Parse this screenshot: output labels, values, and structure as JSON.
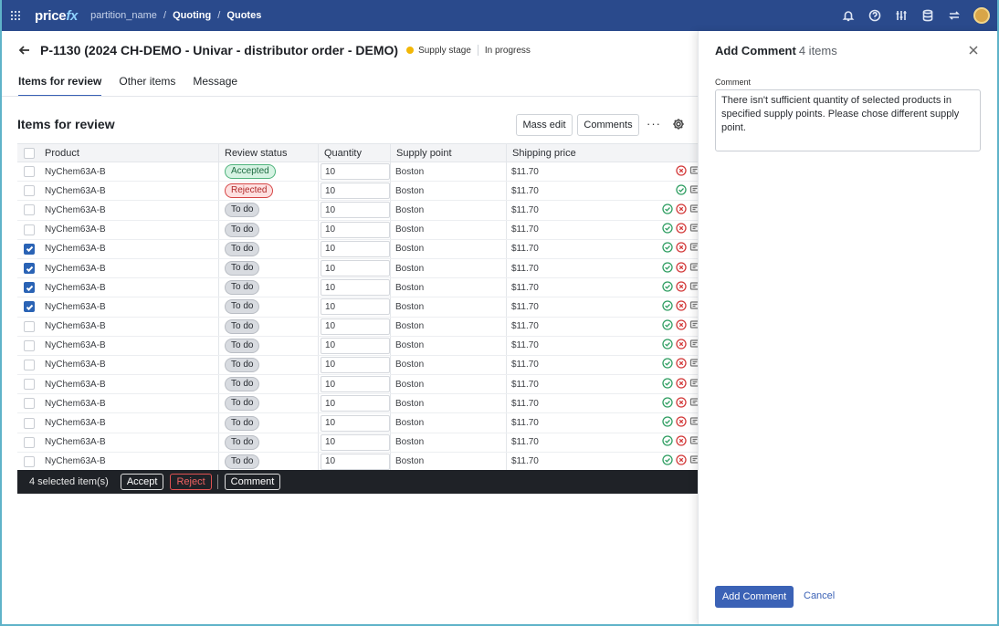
{
  "topbar": {
    "logo_main": "price",
    "logo_fx": "fx",
    "partition": "partition_name",
    "crumb_sep": "/",
    "crumb_quoting": "Quoting",
    "crumb_quotes": "Quotes"
  },
  "header": {
    "title": "P-1130 (2024 CH-DEMO - Univar - distributor order - DEMO)",
    "stage": "Supply stage",
    "status": "In progress"
  },
  "tabs": [
    {
      "label": "Items for review",
      "active": true
    },
    {
      "label": "Other items",
      "active": false
    },
    {
      "label": "Message",
      "active": false
    }
  ],
  "section": {
    "title": "Items for review",
    "mass_edit": "Mass edit",
    "comments": "Comments",
    "more": "···"
  },
  "table": {
    "columns": [
      "Product",
      "Review status",
      "Quantity",
      "Supply point",
      "Shipping price"
    ],
    "rows": [
      {
        "product": "NyChem63A-B",
        "status": "Accepted",
        "kind": "acc",
        "qty": "10",
        "supply": "Boston",
        "price": "$11.70",
        "checked": false,
        "actions": "no"
      },
      {
        "product": "NyChem63A-B",
        "status": "Rejected",
        "kind": "rej",
        "qty": "10",
        "supply": "Boston",
        "price": "$11.70",
        "checked": false,
        "actions": "ok"
      },
      {
        "product": "NyChem63A-B",
        "status": "To do",
        "kind": "todo",
        "qty": "10",
        "supply": "Boston",
        "price": "$11.70",
        "checked": false,
        "actions": "both"
      },
      {
        "product": "NyChem63A-B",
        "status": "To do",
        "kind": "todo",
        "qty": "10",
        "supply": "Boston",
        "price": "$11.70",
        "checked": false,
        "actions": "both"
      },
      {
        "product": "NyChem63A-B",
        "status": "To do",
        "kind": "todo",
        "qty": "10",
        "supply": "Boston",
        "price": "$11.70",
        "checked": true,
        "actions": "both"
      },
      {
        "product": "NyChem63A-B",
        "status": "To do",
        "kind": "todo",
        "qty": "10",
        "supply": "Boston",
        "price": "$11.70",
        "checked": true,
        "actions": "both"
      },
      {
        "product": "NyChem63A-B",
        "status": "To do",
        "kind": "todo",
        "qty": "10",
        "supply": "Boston",
        "price": "$11.70",
        "checked": true,
        "actions": "both"
      },
      {
        "product": "NyChem63A-B",
        "status": "To do",
        "kind": "todo",
        "qty": "10",
        "supply": "Boston",
        "price": "$11.70",
        "checked": true,
        "actions": "both"
      },
      {
        "product": "NyChem63A-B",
        "status": "To do",
        "kind": "todo",
        "qty": "10",
        "supply": "Boston",
        "price": "$11.70",
        "checked": false,
        "actions": "both"
      },
      {
        "product": "NyChem63A-B",
        "status": "To do",
        "kind": "todo",
        "qty": "10",
        "supply": "Boston",
        "price": "$11.70",
        "checked": false,
        "actions": "both"
      },
      {
        "product": "NyChem63A-B",
        "status": "To do",
        "kind": "todo",
        "qty": "10",
        "supply": "Boston",
        "price": "$11.70",
        "checked": false,
        "actions": "both"
      },
      {
        "product": "NyChem63A-B",
        "status": "To do",
        "kind": "todo",
        "qty": "10",
        "supply": "Boston",
        "price": "$11.70",
        "checked": false,
        "actions": "both"
      },
      {
        "product": "NyChem63A-B",
        "status": "To do",
        "kind": "todo",
        "qty": "10",
        "supply": "Boston",
        "price": "$11.70",
        "checked": false,
        "actions": "both"
      },
      {
        "product": "NyChem63A-B",
        "status": "To do",
        "kind": "todo",
        "qty": "10",
        "supply": "Boston",
        "price": "$11.70",
        "checked": false,
        "actions": "both"
      },
      {
        "product": "NyChem63A-B",
        "status": "To do",
        "kind": "todo",
        "qty": "10",
        "supply": "Boston",
        "price": "$11.70",
        "checked": false,
        "actions": "both"
      },
      {
        "product": "NyChem63A-B",
        "status": "To do",
        "kind": "todo",
        "qty": "10",
        "supply": "Boston",
        "price": "$11.70",
        "checked": false,
        "actions": "both"
      }
    ]
  },
  "actionbar": {
    "selected": "4 selected item(s)",
    "accept": "Accept",
    "reject": "Reject",
    "comment": "Comment"
  },
  "panel": {
    "title": "Add Comment",
    "count": "4 items",
    "field_label": "Comment",
    "comment_value": "There isn't sufficient quantity of selected products in specified supply points. Please chose different supply point.",
    "submit": "Add Comment",
    "cancel": "Cancel"
  },
  "colors": {
    "topbar": "#2a4a8c",
    "accent": "#3b62b6",
    "stage_dot": "#f2b707",
    "accepted": "#4fb37c",
    "rejected": "#d64545"
  }
}
